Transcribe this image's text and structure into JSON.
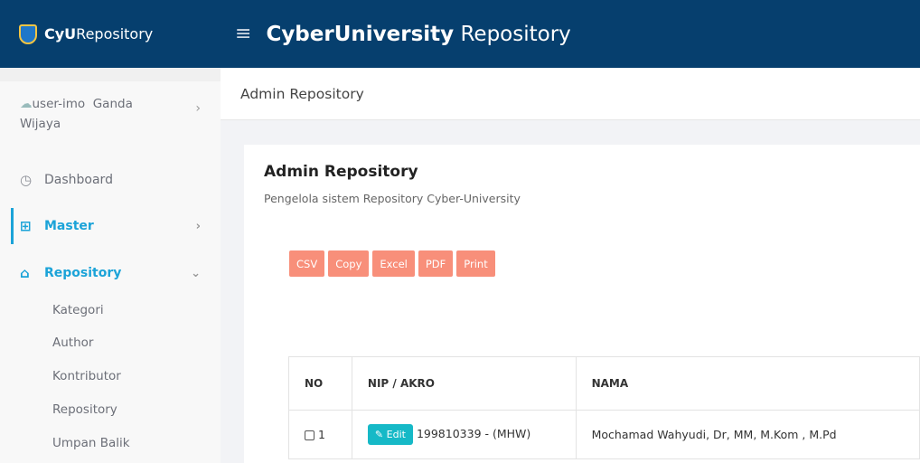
{
  "brand": {
    "strong": "CyU",
    "rest": "Repository"
  },
  "header": {
    "strong": "CyberUniversity",
    "rest": "Repository"
  },
  "breadcrumb": "Admin Repository",
  "user": {
    "image_alt": "user-imo",
    "name_line1": "Ganda",
    "name_line2": "Wijaya"
  },
  "menu": {
    "dashboard": "Dashboard",
    "master": "Master",
    "repository": "Repository",
    "submenu": [
      "Kategori",
      "Author",
      "Kontributor",
      "Repository",
      "Umpan Balik"
    ]
  },
  "card": {
    "title": "Admin Repository",
    "subtitle": "Pengelola sistem Repository Cyber-University"
  },
  "export_buttons": [
    "CSV",
    "Copy",
    "Excel",
    "PDF",
    "Print"
  ],
  "table": {
    "headers": [
      "NO",
      "NIP / AKRO",
      "NAMA"
    ],
    "rows": [
      {
        "no": "1",
        "edit": "Edit",
        "nip": "199810339 - (MHW)",
        "nama": "Mochamad Wahyudi, Dr, MM, M.Kom , M.Pd"
      }
    ]
  },
  "colors": {
    "header_bg": "#063f6e",
    "accent": "#1ba3d8",
    "export_button": "#f88f7a",
    "edit_button": "#16b9c7"
  }
}
